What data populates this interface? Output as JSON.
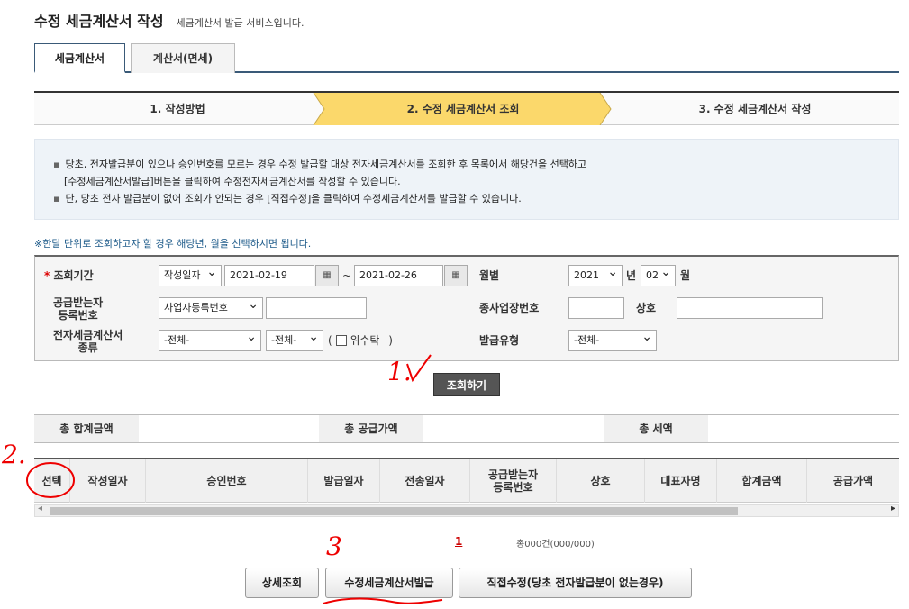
{
  "header": {
    "title": "수정 세금계산서 작성",
    "desc": "세금계산서 발급 서비스입니다."
  },
  "tabs": [
    {
      "label": "세금계산서"
    },
    {
      "label": "계산서(면세)"
    }
  ],
  "steps": [
    {
      "label": "1. 작성방법"
    },
    {
      "label": "2. 수정 세금계산서 조회"
    },
    {
      "label": "3. 수정 세금계산서 작성"
    }
  ],
  "info": {
    "line1": "당초, 전자발급분이 있으나 승인번호를 모르는 경우 수정 발급할 대상 전자세금계산서를 조회한 후 목록에서 해당건을 선택하고",
    "line2": "[수정세금계산서발급]버튼을 클릭하여 수정전자세금계산서를 작성할 수 있습니다.",
    "line3": "단, 당초 전자 발급분이 없어 조회가 안되는 경우 [직접수정]을 클릭하여 수정세금계산서를 발급할 수 있습니다."
  },
  "notice": "※한달 단위로 조회하고자 할 경우 해당년, 월을 선택하시면 됩니다.",
  "search": {
    "period_label": "조회기간",
    "required_mark": "*",
    "date_type": "작성일자",
    "date_from": "2021-02-19",
    "tilde": "~",
    "date_to": "2021-02-26",
    "monthly_label": "월별",
    "year": "2021",
    "year_unit": "년",
    "month": "02",
    "month_unit": "월",
    "buyer_reg_label_1": "공급받는자",
    "buyer_reg_label_2": "등록번호",
    "buyer_reg_type": "사업자등록번호",
    "buyer_reg_value": "",
    "sub_biz_label": "종사업장번호",
    "sub_biz_value": "",
    "company_label": "상호",
    "company_value": "",
    "kind_label_1": "전자세금계산서",
    "kind_label_2": "종류",
    "kind1": "-전체-",
    "kind2": "-전체-",
    "entrust_prefix": "(",
    "entrust_label": "위수탁",
    "entrust_suffix": ")",
    "issue_type_label": "발급유형",
    "issue_type": "-전체-",
    "search_button": "조회하기"
  },
  "totals": {
    "sum_label": "총 합계금액",
    "supply_label": "총 공급가액",
    "tax_label": "총 세액",
    "sum": "",
    "supply": "",
    "tax": ""
  },
  "grid": {
    "columns": [
      "선택",
      "작성일자",
      "승인번호",
      "발급일자",
      "전송일자",
      "공급받는자 등록번호",
      "상호",
      "대표자명",
      "합계금액",
      "공급가액"
    ]
  },
  "scrollbar": {
    "left_arrow": "◂",
    "right_arrow": "▸"
  },
  "pager": {
    "page": "1",
    "count": "총000건(000/000)"
  },
  "buttons": {
    "detail": "상세조회",
    "amend": "수정세금계산서발급",
    "direct": "직접수정(당초 전자발급분이 없는경우)"
  },
  "annotations": {
    "a1": "1.",
    "a2": "2.",
    "a3": "3"
  }
}
